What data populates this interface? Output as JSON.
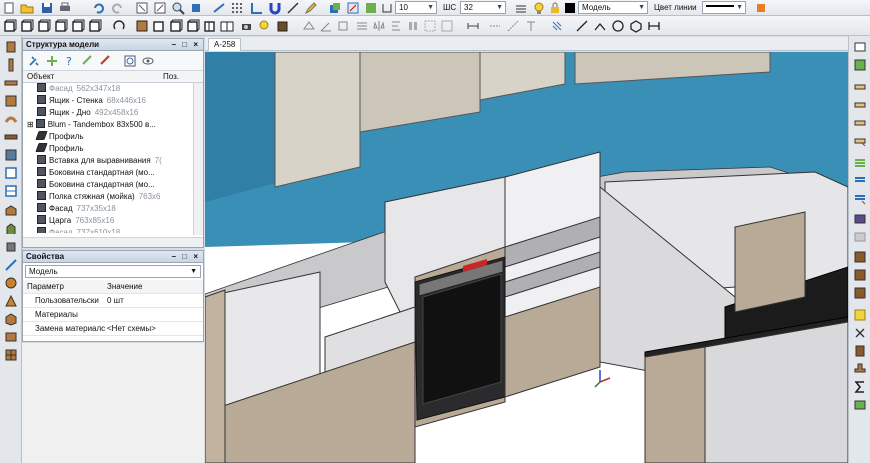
{
  "toolbar_top": {
    "line_width_value": "10",
    "line_width_label": "Ш",
    "step_label": "ШС",
    "step_value": "32",
    "layer_value": "Модель",
    "line_color_label": "Цвет линии"
  },
  "structure_panel": {
    "title": "Структура модели",
    "window_buttons": "– □ ×",
    "col_object": "Объект",
    "col_pos": "Поз.",
    "rows": [
      {
        "name": "Фасад",
        "dims": "562x347x18",
        "dim": true
      },
      {
        "name": "Ящик - Стенка",
        "dims": "68x446x16"
      },
      {
        "name": "Ящик - Дно",
        "dims": "492x458x16"
      },
      {
        "name": "Blum - Tandembox 83x500 в...",
        "dims": ""
      },
      {
        "name": "Профиль",
        "dims": ""
      },
      {
        "name": "Профиль",
        "dims": ""
      },
      {
        "name": "Вставка для выравнивания",
        "dims": "7("
      },
      {
        "name": "Боковина стандартная (мо...",
        "dims": ""
      },
      {
        "name": "Боковина стандартная (мо...",
        "dims": ""
      },
      {
        "name": "Полка стяжная (мойка)",
        "dims": "763x6"
      },
      {
        "name": "Фасад",
        "dims": "737x35x18"
      },
      {
        "name": "Царга",
        "dims": "763x85x16"
      },
      {
        "name": "Фасад",
        "dims": "737x610x18",
        "dim": true
      }
    ]
  },
  "properties_panel": {
    "title": "Свойства",
    "window_buttons": "– □ ×",
    "selector_value": "Модель",
    "col_param": "Параметр",
    "col_value": "Значение",
    "rows": [
      {
        "param": "Пользовательски",
        "value": "0 шт"
      },
      {
        "param": "Материалы",
        "value": ""
      },
      {
        "param": "Замена материалс",
        "value": "<Нет схемы>"
      }
    ]
  },
  "document_tab": "A-258",
  "colors": {
    "wall_blue": "#3a8fb7",
    "carcass": "#d9d9dc",
    "facade_wood": "#b9aa98",
    "countertop": "#1b1b1b"
  }
}
